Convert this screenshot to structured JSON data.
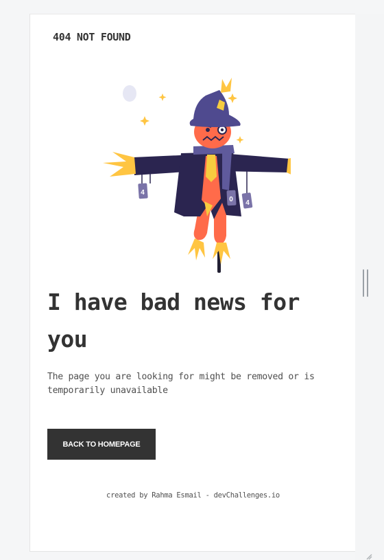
{
  "header": {
    "brand": "404 NOT FOUND"
  },
  "illustration": {
    "subject": "scarecrow",
    "sign_digits": [
      "4",
      "0",
      "4"
    ],
    "colors": {
      "hat": "#4f4a8f",
      "coat": "#2b2550",
      "face": "#ff6b4a",
      "straw": "#ffc542",
      "scarf": "#5f5a9c",
      "tie": "#f7cc3f",
      "can": "#7a73a8",
      "moon": "#e6e7f4",
      "pole": "#222033"
    }
  },
  "main": {
    "headline": "I have bad news for you",
    "description": "The page you are looking for might be removed or is temporarily unavailable",
    "button_label": "BACK TO HOMEPAGE"
  },
  "footer": {
    "text": "created by Rahma Esmail - devChallenges.io"
  },
  "colors": {
    "text_dark": "#333333",
    "text_muted": "#4f4f4f",
    "button_bg": "#333333",
    "button_text": "#ffffff",
    "page_bg": "#ffffff"
  }
}
